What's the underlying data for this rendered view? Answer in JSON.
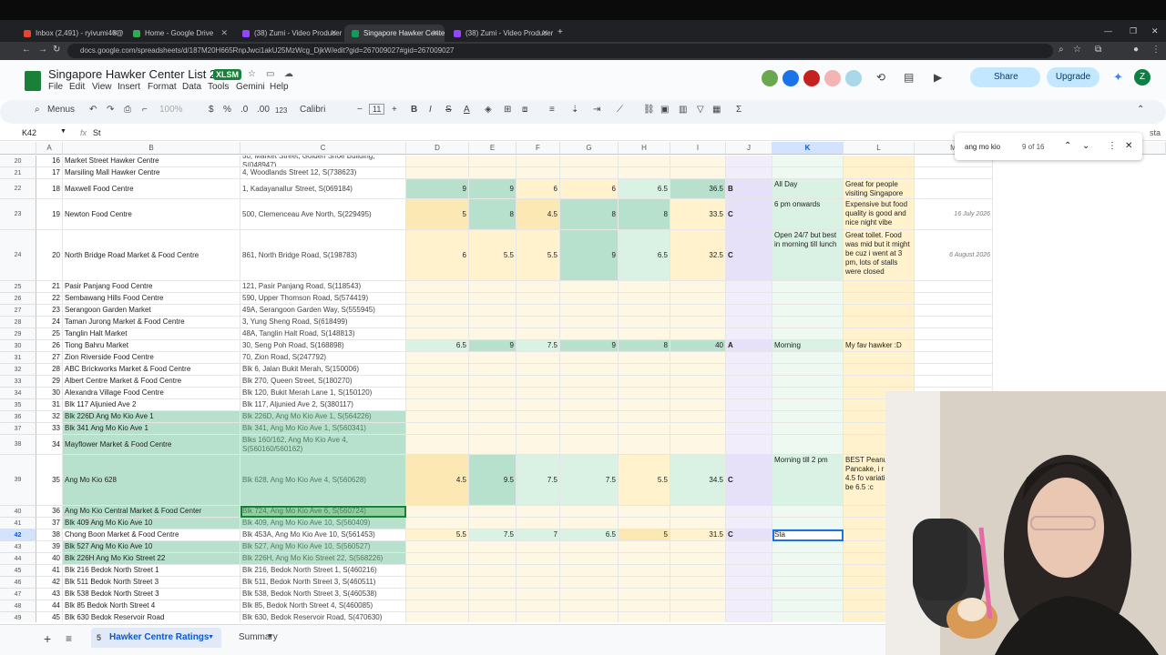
{
  "browser": {
    "tabs": [
      {
        "label": "Inbox (2,491) - ryivumi46@gm..."
      },
      {
        "label": "Home - Google Drive"
      },
      {
        "label": "(38) Zumi - Video Producer - Tw..."
      },
      {
        "label": "Singapore Hawker Center List 2..."
      },
      {
        "label": "(38) Zumi - Video Producer - Tw..."
      }
    ],
    "url": "docs.google.com/spreadsheets/d/187M20H665RnpJwci1akU25MzWcg_DjkW/edit?gid=267009027#gid=267009027"
  },
  "doc": {
    "title": "Singapore Hawker Center List 2026",
    "badge": "XLSM",
    "menus": [
      "File",
      "Edit",
      "View",
      "Insert",
      "Format",
      "Data",
      "Tools",
      "Gemini",
      "Help"
    ],
    "share_label": "Share",
    "upgrade_label": "Upgrade",
    "avatar_letter": "Z"
  },
  "toolbar": {
    "menus_label": "Menus",
    "zoom": "100%",
    "currency": "$",
    "percent": "%",
    "dec_less": ".0",
    "dec_more": ".00",
    "number_fmt": "123",
    "font": "Calibri",
    "font_size": "11",
    "bold": "B",
    "italic": "I",
    "underline": "A"
  },
  "formula_bar": {
    "cell_ref": "K42",
    "fx": "fx",
    "content": "St"
  },
  "find": {
    "query": "ang mo kio",
    "count": "9 of 16"
  },
  "columns": [
    "A",
    "B",
    "C",
    "D",
    "E",
    "F",
    "G",
    "H",
    "I",
    "J",
    "K",
    "L",
    "M"
  ],
  "rows": [
    {
      "r": "20",
      "a": "16",
      "b": "Market Street Hawker Centre",
      "c": "50, Market Street, Golden Shoe Building, S(048947)",
      "d": "",
      "e": "",
      "f": "",
      "g": "",
      "h": "",
      "i": "",
      "j": "",
      "k": "",
      "l": "",
      "m": ""
    },
    {
      "r": "21",
      "a": "17",
      "b": "Marsiling Mall Hawker Centre",
      "c": "4, Woodlands Street 12, S(738623)",
      "d": "",
      "e": "",
      "f": "",
      "g": "",
      "h": "",
      "i": "",
      "j": "",
      "k": "",
      "l": "",
      "m": ""
    },
    {
      "r": "22",
      "a": "18",
      "b": "Maxwell Food Centre",
      "c": "1, Kadayanallur Street, S(069184)",
      "d": "9",
      "e": "9",
      "f": "6",
      "g": "6",
      "h": "6.5",
      "i": "36.5",
      "j": "B",
      "k": "All Day",
      "l": "Great for people visiting Singapore",
      "m": ""
    },
    {
      "r": "23",
      "a": "19",
      "b": "Newton Food Centre",
      "c": "500, Clemenceau Ave North, S(229495)",
      "d": "5",
      "e": "8",
      "f": "4.5",
      "g": "8",
      "h": "8",
      "i": "33.5",
      "j": "C",
      "k": "6 pm onwards",
      "l": "Expensive but food quality is good and nice night vibe",
      "m": "16 July 2026"
    },
    {
      "r": "24",
      "a": "20",
      "b": "North Bridge Road Market & Food Centre",
      "c": "861, North Bridge Road, S(198783)",
      "d": "6",
      "e": "5.5",
      "f": "5.5",
      "g": "9",
      "h": "6.5",
      "i": "32.5",
      "j": "C",
      "k": "Open 24/7 but best in morning till lunch",
      "l": "Great toilet. Food was mid but it might be cuz i went at 3 pm, lots of stalls were closed",
      "m": "6 August 2026"
    },
    {
      "r": "25",
      "a": "21",
      "b": "Pasir Panjang Food Centre",
      "c": "121, Pasir Panjang Road, S(118543)",
      "d": "",
      "e": "",
      "f": "",
      "g": "",
      "h": "",
      "i": "",
      "j": "",
      "k": "",
      "l": "",
      "m": ""
    },
    {
      "r": "26",
      "a": "22",
      "b": "Sembawang Hills Food Centre",
      "c": "590, Upper Thomson Road, S(574419)",
      "d": "",
      "e": "",
      "f": "",
      "g": "",
      "h": "",
      "i": "",
      "j": "",
      "k": "",
      "l": "",
      "m": ""
    },
    {
      "r": "27",
      "a": "23",
      "b": "Serangoon Garden Market",
      "c": "49A, Serangoon Garden Way, S(555945)",
      "d": "",
      "e": "",
      "f": "",
      "g": "",
      "h": "",
      "i": "",
      "j": "",
      "k": "",
      "l": "",
      "m": ""
    },
    {
      "r": "28",
      "a": "24",
      "b": "Taman Jurong Market & Food Centre",
      "c": "3, Yung Sheng Road, S(618499)",
      "d": "",
      "e": "",
      "f": "",
      "g": "",
      "h": "",
      "i": "",
      "j": "",
      "k": "",
      "l": "",
      "m": ""
    },
    {
      "r": "29",
      "a": "25",
      "b": "Tanglin Halt Market",
      "c": "48A, Tanglin Halt Road, S(148813)",
      "d": "",
      "e": "",
      "f": "",
      "g": "",
      "h": "",
      "i": "",
      "j": "",
      "k": "",
      "l": "",
      "m": ""
    },
    {
      "r": "30",
      "a": "26",
      "b": "Tiong Bahru Market",
      "c": "30, Seng Poh Road, S(168898)",
      "d": "6.5",
      "e": "9",
      "f": "7.5",
      "g": "9",
      "h": "8",
      "i": "40",
      "j": "A",
      "k": "Morning",
      "l": "My fav hawker :D",
      "m": ""
    },
    {
      "r": "31",
      "a": "27",
      "b": "Zion Riverside Food Centre",
      "c": "70, Zion Road, S(247792)",
      "d": "",
      "e": "",
      "f": "",
      "g": "",
      "h": "",
      "i": "",
      "j": "",
      "k": "",
      "l": "",
      "m": ""
    },
    {
      "r": "32",
      "a": "28",
      "b": "ABC Brickworks Market & Food Centre",
      "c": "Blk 6, Jalan Bukit Merah, S(150006)",
      "d": "",
      "e": "",
      "f": "",
      "g": "",
      "h": "",
      "i": "",
      "j": "",
      "k": "",
      "l": "",
      "m": ""
    },
    {
      "r": "33",
      "a": "29",
      "b": "Albert Centre Market & Food Centre",
      "c": "Blk 270, Queen Street, S(180270)",
      "d": "",
      "e": "",
      "f": "",
      "g": "",
      "h": "",
      "i": "",
      "j": "",
      "k": "",
      "l": "",
      "m": ""
    },
    {
      "r": "34",
      "a": "30",
      "b": "Alexandra Village Food Centre",
      "c": "Blk 120, Bukit Merah Lane 1, S(150120)",
      "d": "",
      "e": "",
      "f": "",
      "g": "",
      "h": "",
      "i": "",
      "j": "",
      "k": "",
      "l": "",
      "m": ""
    },
    {
      "r": "35",
      "a": "31",
      "b": "Blk 117 Aljunied Ave 2",
      "c": "Blk 117, Aljunied Ave 2, S(380117)",
      "d": "",
      "e": "",
      "f": "",
      "g": "",
      "h": "",
      "i": "",
      "j": "",
      "k": "",
      "l": "",
      "m": ""
    },
    {
      "r": "36",
      "a": "32",
      "b": "Blk 226D Ang Mo Kio Ave 1",
      "c": "Blk 226D, Ang Mo Kio Ave 1, S(564226)",
      "d": "",
      "e": "",
      "f": "",
      "g": "",
      "h": "",
      "i": "",
      "j": "",
      "k": "",
      "l": "",
      "m": ""
    },
    {
      "r": "37",
      "a": "33",
      "b": "Blk 341 Ang Mo Kio Ave 1",
      "c": "Blk 341, Ang Mo Kio Ave 1, S(560341)",
      "d": "",
      "e": "",
      "f": "",
      "g": "",
      "h": "",
      "i": "",
      "j": "",
      "k": "",
      "l": "",
      "m": ""
    },
    {
      "r": "38",
      "a": "34",
      "b": "Mayflower Market & Food Centre",
      "c": "Blks 160/162, Ang Mo Kio Ave 4, S(560160/560162)",
      "d": "",
      "e": "",
      "f": "",
      "g": "",
      "h": "",
      "i": "",
      "j": "",
      "k": "",
      "l": "",
      "m": ""
    },
    {
      "r": "39",
      "a": "35",
      "b": "Ang Mo Kio 628",
      "c": "Blk 628, Ang Mo Kio Ave 4, S(560628)",
      "d": "4.5",
      "e": "9.5",
      "f": "7.5",
      "g": "7.5",
      "h": "5.5",
      "i": "34.5",
      "j": "C",
      "k": "Morning till 2 pm",
      "l": "BEST Peanut Pancake, i r giving 4.5 fo variation - sh be 6.5 :c",
      "m": ""
    },
    {
      "r": "40",
      "a": "36",
      "b": "Ang Mo Kio Central Market & Food Center",
      "c": "Blk 724, Ang Mo Kio Ave 6, S(560724)",
      "d": "",
      "e": "",
      "f": "",
      "g": "",
      "h": "",
      "i": "",
      "j": "",
      "k": "",
      "l": "",
      "m": ""
    },
    {
      "r": "41",
      "a": "37",
      "b": "Blk 409 Ang Mo Kio Ave 10",
      "c": "Blk 409, Ang Mo Kio Ave 10, S(560409)",
      "d": "",
      "e": "",
      "f": "",
      "g": "",
      "h": "",
      "i": "",
      "j": "",
      "k": "",
      "l": "",
      "m": ""
    },
    {
      "r": "42",
      "a": "38",
      "b": "Chong Boon Market & Food Centre",
      "c": "Blk 453A, Ang Mo Kio Ave 10, S(561453)",
      "d": "5.5",
      "e": "7.5",
      "f": "7",
      "g": "6.5",
      "h": "5",
      "i": "31.5",
      "j": "C",
      "k": "Sta",
      "l": "",
      "m": ""
    },
    {
      "r": "43",
      "a": "39",
      "b": "Blk 527 Ang Mo Kio Ave 10",
      "c": "Blk 527, Ang Mo Kio Ave 10, S(560527)",
      "d": "",
      "e": "",
      "f": "",
      "g": "",
      "h": "",
      "i": "",
      "j": "",
      "k": "",
      "l": "",
      "m": ""
    },
    {
      "r": "44",
      "a": "40",
      "b": "Blk 226H Ang Mo Kio Street 22",
      "c": "Blk 226H, Ang Mo Kio Street 22, S(568226)",
      "d": "",
      "e": "",
      "f": "",
      "g": "",
      "h": "",
      "i": "",
      "j": "",
      "k": "",
      "l": "",
      "m": ""
    },
    {
      "r": "45",
      "a": "41",
      "b": "Blk 216 Bedok North Street 1",
      "c": "Blk 216, Bedok North Street 1, S(460216)",
      "d": "",
      "e": "",
      "f": "",
      "g": "",
      "h": "",
      "i": "",
      "j": "",
      "k": "",
      "l": "",
      "m": ""
    },
    {
      "r": "46",
      "a": "42",
      "b": "Blk 511 Bedok North Street 3",
      "c": "Blk 511, Bedok North Street 3, S(460511)",
      "d": "",
      "e": "",
      "f": "",
      "g": "",
      "h": "",
      "i": "",
      "j": "",
      "k": "",
      "l": "",
      "m": ""
    },
    {
      "r": "47",
      "a": "43",
      "b": "Blk 538 Bedok North Street 3",
      "c": "Blk 538, Bedok North Street 3, S(460538)",
      "d": "",
      "e": "",
      "f": "",
      "g": "",
      "h": "",
      "i": "",
      "j": "",
      "k": "",
      "l": "",
      "m": ""
    },
    {
      "r": "48",
      "a": "44",
      "b": "Blk 85 Bedok North Street 4",
      "c": "Blk 85, Bedok North Street 4, S(460085)",
      "d": "",
      "e": "",
      "f": "",
      "g": "",
      "h": "",
      "i": "",
      "j": "",
      "k": "",
      "l": "",
      "m": ""
    },
    {
      "r": "49",
      "a": "45",
      "b": "Blk 630 Bedok Reservoir Road",
      "c": "Blk 630, Bedok Reservoir Road, S(470630)",
      "d": "",
      "e": "",
      "f": "",
      "g": "",
      "h": "",
      "i": "",
      "j": "",
      "k": "",
      "l": "",
      "m": ""
    }
  ],
  "sheets": {
    "active": "Hawker Centre Ratings",
    "other": "Summary",
    "count_badge": "5"
  },
  "colors": {
    "accent": "#0b57d0",
    "sheets_green": "#188038",
    "score_green": "#b7e1cd",
    "score_yellow": "#fce8b2"
  }
}
